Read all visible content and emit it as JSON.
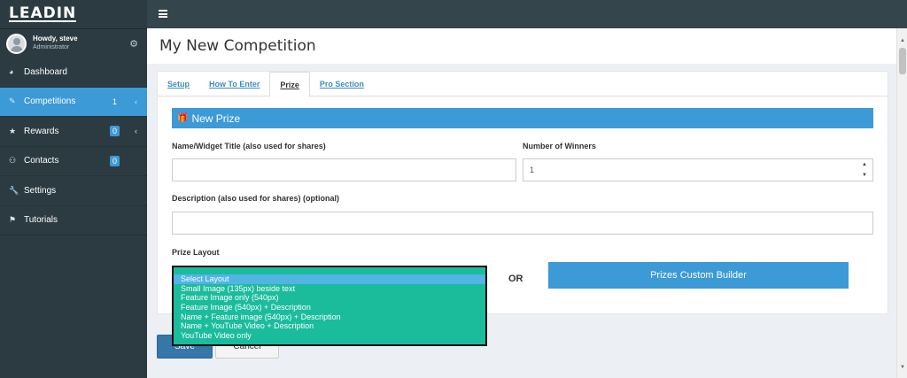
{
  "brand": {
    "logo": "LEADIN"
  },
  "user": {
    "greeting": "Howdy, steve",
    "role": "Administrator"
  },
  "sidebar": {
    "items": [
      {
        "label": "Dashboard",
        "icon": "dashboard-icon",
        "badge": ""
      },
      {
        "label": "Competitions",
        "icon": "pencil-icon",
        "badge": "1"
      },
      {
        "label": "Rewards",
        "icon": "star-icon",
        "badge": "0"
      },
      {
        "label": "Contacts",
        "icon": "users-icon",
        "badge": "0"
      },
      {
        "label": "Settings",
        "icon": "wrench-icon",
        "badge": ""
      },
      {
        "label": "Tutorials",
        "icon": "tag-icon",
        "badge": ""
      }
    ]
  },
  "page": {
    "title": "My New Competition"
  },
  "tabs": [
    "Setup",
    "How To Enter",
    "Prize",
    "Pro Section"
  ],
  "prize": {
    "header": "New Prize",
    "name_label": "Name/Widget Title (also used for shares)",
    "name_value": "",
    "winners_label": "Number of Winners",
    "winners_value": "1",
    "description_label": "Description (also used for shares) (optional)",
    "description_value": "",
    "layout_label": "Prize Layout",
    "layout_options": [
      "Select Layout",
      "Small Image (135px) beside text",
      "Feature Image only (540px)",
      "Feature Image (540px) + Description",
      "Name + Feature image (540px) + Description",
      "Name + YouTube Video + Description",
      "YouTube Video only"
    ],
    "or_text": "OR",
    "builder_button": "Prizes Custom Builder"
  },
  "actions": {
    "save": "Save",
    "cancel": "Cancel"
  },
  "colors": {
    "accent": "#3c9ad7",
    "sidebar": "#2c3b41",
    "dropdown": "#1abc9c"
  }
}
